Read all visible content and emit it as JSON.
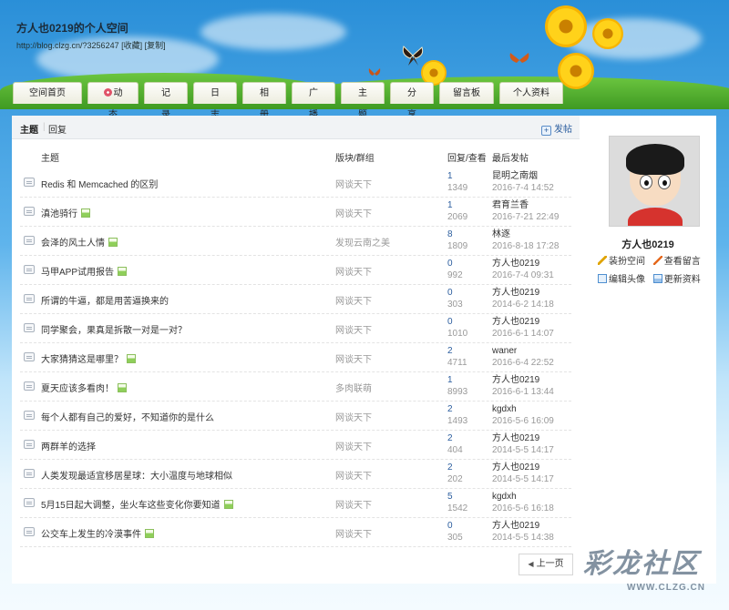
{
  "header": {
    "title": "方人也0219的个人空间",
    "url": "http://blog.clzg.cn/?3256247",
    "favorite_label": "[收藏]",
    "copy_label": "[复制]"
  },
  "nav": [
    {
      "label": "空间首页"
    },
    {
      "label": "动态"
    },
    {
      "label": "记录"
    },
    {
      "label": "日志"
    },
    {
      "label": "相册"
    },
    {
      "label": "广播"
    },
    {
      "label": "主题"
    },
    {
      "label": "分享"
    },
    {
      "label": "留言板"
    },
    {
      "label": "个人资料"
    }
  ],
  "subbar": {
    "tab_topics": "主题",
    "separator": "|",
    "tab_replies": "回复",
    "post_label": "发帖"
  },
  "table": {
    "col_subject": "主题",
    "col_forum": "版块/群组",
    "col_stats": "回复/查看",
    "col_last": "最后发帖",
    "rows": [
      {
        "subject": "Redis 和 Memcached 的区别",
        "has_image": false,
        "forum": "网谈天下",
        "replies": "1",
        "views": "1349",
        "last_user": "昆明之南烟",
        "last_date": "2016-7-4 14:52"
      },
      {
        "subject": "滇池骑行",
        "has_image": true,
        "forum": "网谈天下",
        "replies": "1",
        "views": "2069",
        "last_user": "君育兰香",
        "last_date": "2016-7-21 22:49"
      },
      {
        "subject": "会泽的风土人情",
        "has_image": true,
        "forum": "发现云南之美",
        "replies": "8",
        "views": "1809",
        "last_user": "林逐",
        "last_date": "2016-8-18 17:28"
      },
      {
        "subject": "马甲APP试用报告",
        "has_image": true,
        "forum": "网谈天下",
        "replies": "0",
        "views": "992",
        "last_user": "方人也0219",
        "last_date": "2016-7-4 09:31"
      },
      {
        "subject": "所谓的牛逼，都是用苦逼换来的",
        "has_image": false,
        "forum": "网谈天下",
        "replies": "0",
        "views": "303",
        "last_user": "方人也0219",
        "last_date": "2014-6-2 14:18"
      },
      {
        "subject": "同学聚会，果真是拆散一对是一对？",
        "has_image": false,
        "forum": "网谈天下",
        "replies": "0",
        "views": "1010",
        "last_user": "方人也0219",
        "last_date": "2016-6-1 14:07"
      },
      {
        "subject": "大家猜猜这是哪里？",
        "has_image": true,
        "forum": "网谈天下",
        "replies": "2",
        "views": "4711",
        "last_user": "waner",
        "last_date": "2016-6-4 22:52"
      },
      {
        "subject": "夏天应该多看肉！",
        "has_image": true,
        "forum": "多肉联萌",
        "replies": "1",
        "views": "8993",
        "last_user": "方人也0219",
        "last_date": "2016-6-1 13:44"
      },
      {
        "subject": "每个人都有自己的爱好，不知道你的是什么",
        "has_image": false,
        "forum": "网谈天下",
        "replies": "2",
        "views": "1493",
        "last_user": "kgdxh",
        "last_date": "2016-5-6 16:09"
      },
      {
        "subject": "两群羊的选择",
        "has_image": false,
        "forum": "网谈天下",
        "replies": "2",
        "views": "404",
        "last_user": "方人也0219",
        "last_date": "2014-5-5 14:17"
      },
      {
        "subject": "人类发现最适宜移居星球：大小温度与地球相似",
        "has_image": false,
        "forum": "网谈天下",
        "replies": "2",
        "views": "202",
        "last_user": "方人也0219",
        "last_date": "2014-5-5 14:17"
      },
      {
        "subject": "5月15日起大调整，坐火车这些变化你要知道",
        "has_image": true,
        "forum": "网谈天下",
        "replies": "5",
        "views": "1542",
        "last_user": "kgdxh",
        "last_date": "2016-5-6 16:18"
      },
      {
        "subject": "公交车上发生的冷漠事件",
        "has_image": true,
        "forum": "网谈天下",
        "replies": "0",
        "views": "305",
        "last_user": "方人也0219",
        "last_date": "2014-5-5 14:38"
      }
    ]
  },
  "pager": {
    "prev_label": "上一页"
  },
  "sidebar": {
    "username": "方人也0219",
    "links": [
      {
        "label": "装扮空间",
        "icon": "key-icon"
      },
      {
        "label": "查看留言",
        "icon": "pencil-icon"
      },
      {
        "label": "编辑头像",
        "icon": "picture-icon"
      },
      {
        "label": "更新资料",
        "icon": "profile-card-icon"
      }
    ]
  },
  "watermark": {
    "main": "彩龙社区",
    "sub": "WWW.CLZG.CN"
  },
  "colors": {
    "link_blue": "#2b5d9e",
    "muted_gray": "#999999",
    "sky_blue": "#2a8fd8"
  }
}
